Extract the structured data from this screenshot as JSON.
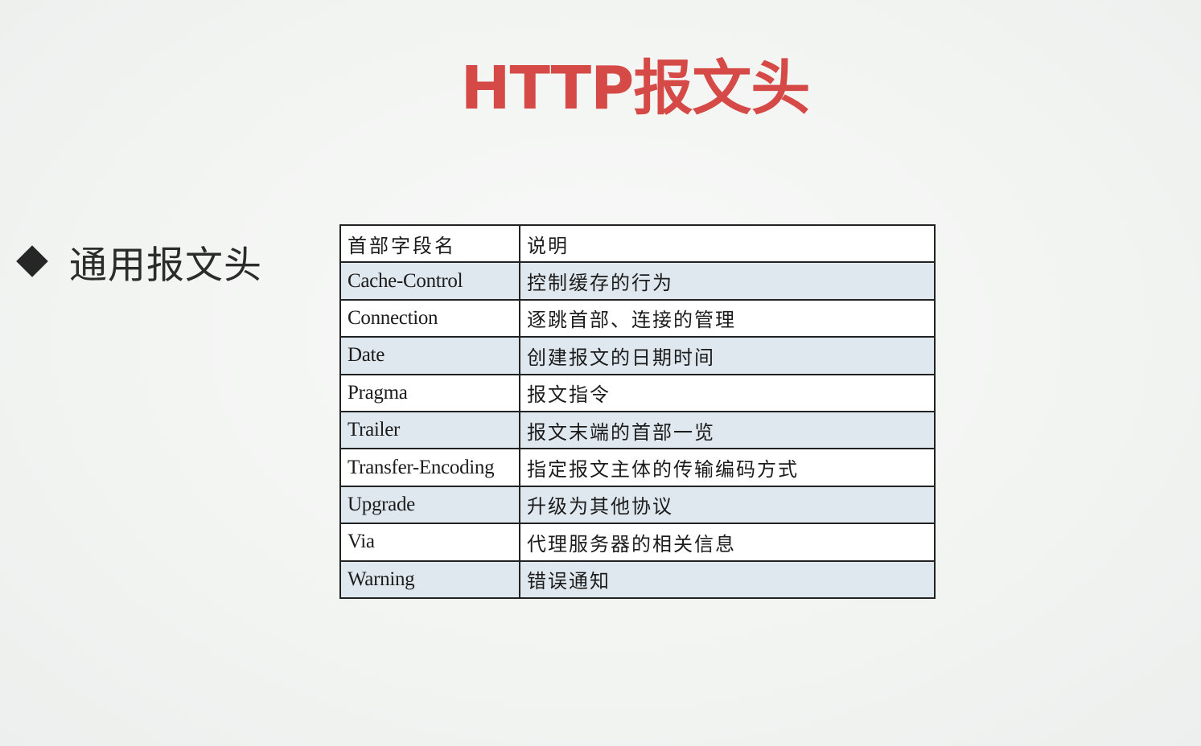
{
  "title": "HTTP报文头",
  "bullet": {
    "icon": "diamond-bullet-icon",
    "text": "通用报文头"
  },
  "table": {
    "headers": [
      "首部字段名",
      "说明"
    ],
    "rows": [
      [
        "Cache-Control",
        "控制缓存的行为"
      ],
      [
        "Connection",
        "逐跳首部、连接的管理"
      ],
      [
        "Date",
        "创建报文的日期时间"
      ],
      [
        "Pragma",
        "报文指令"
      ],
      [
        "Trailer",
        "报文末端的首部一览"
      ],
      [
        "Transfer-Encoding",
        "指定报文主体的传输编码方式"
      ],
      [
        "Upgrade",
        "升级为其他协议"
      ],
      [
        "Via",
        "代理服务器的相关信息"
      ],
      [
        "Warning",
        "错误通知"
      ]
    ]
  },
  "colors": {
    "title": "#d54a47",
    "row_shade": "#dfe8ee",
    "text": "#1c1c1c"
  }
}
